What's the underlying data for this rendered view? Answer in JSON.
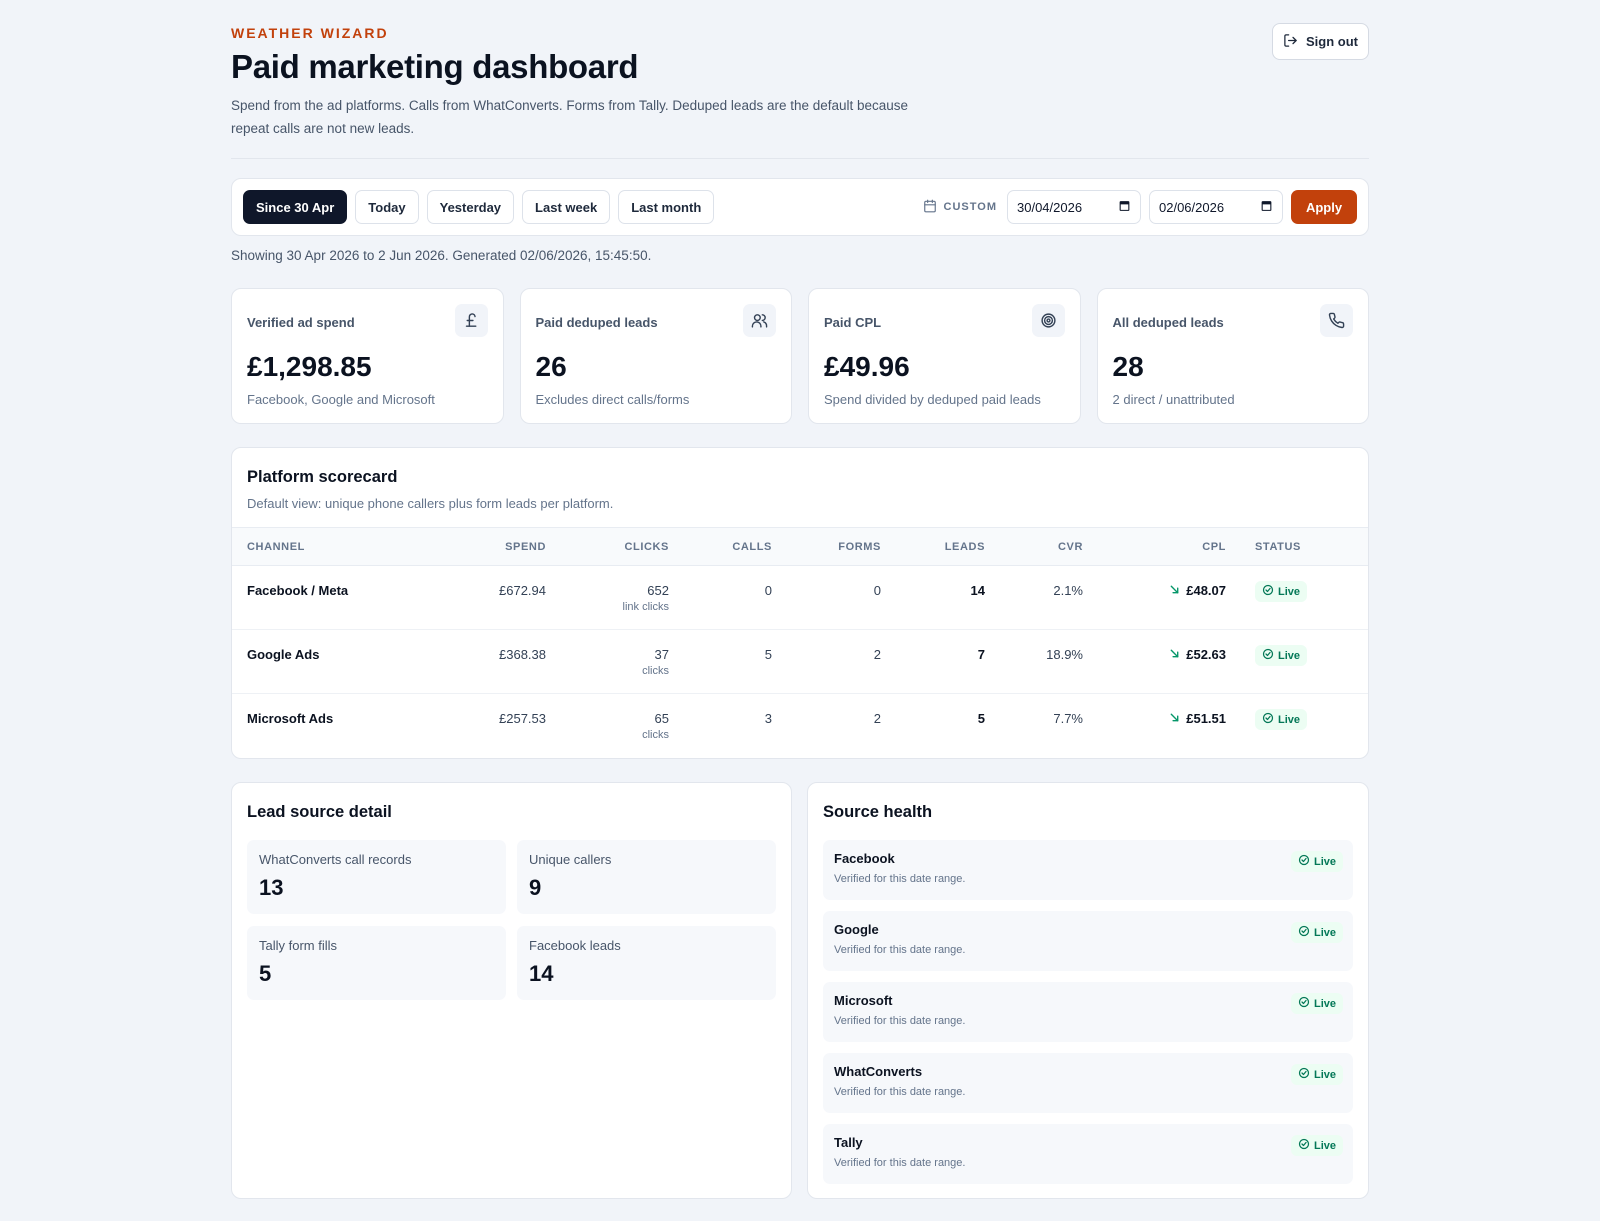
{
  "brand": "WEATHER WIZARD",
  "title": "Paid marketing dashboard",
  "subtitle": "Spend from the ad platforms. Calls from WhatConverts. Forms from Tally. Deduped leads are the default because repeat calls are not new leads.",
  "signout_label": "Sign out",
  "filters": {
    "presets": [
      "Since 30 Apr",
      "Today",
      "Yesterday",
      "Last week",
      "Last month"
    ],
    "custom_label": "CUSTOM",
    "from_date": "30/04/2026",
    "to_date": "02/06/2026",
    "apply_label": "Apply"
  },
  "showing": "Showing 30 Apr 2026 to 2 Jun 2026. Generated 02/06/2026, 15:45:50.",
  "kpis": [
    {
      "label": "Verified ad spend",
      "value": "£1,298.85",
      "note": "Facebook, Google and Microsoft",
      "icon": "pound-icon"
    },
    {
      "label": "Paid deduped leads",
      "value": "26",
      "note": "Excludes direct calls/forms",
      "icon": "users-icon"
    },
    {
      "label": "Paid CPL",
      "value": "£49.96",
      "note": "Spend divided by deduped paid leads",
      "icon": "target-icon"
    },
    {
      "label": "All deduped leads",
      "value": "28",
      "note": "2 direct / unattributed",
      "icon": "phone-icon"
    }
  ],
  "scorecard": {
    "title": "Platform scorecard",
    "subtitle": "Default view: unique phone callers plus form leads per platform.",
    "columns": [
      "CHANNEL",
      "SPEND",
      "CLICKS",
      "CALLS",
      "FORMS",
      "LEADS",
      "CVR",
      "CPL",
      "STATUS"
    ],
    "rows": [
      {
        "channel": "Facebook / Meta",
        "spend": "£672.94",
        "clicks": "652",
        "clicks_note": "link clicks",
        "calls": "0",
        "forms": "0",
        "leads": "14",
        "cvr": "2.1%",
        "cpl": "£48.07",
        "status": "Live"
      },
      {
        "channel": "Google Ads",
        "spend": "£368.38",
        "clicks": "37",
        "clicks_note": "clicks",
        "calls": "5",
        "forms": "2",
        "leads": "7",
        "cvr": "18.9%",
        "cpl": "£52.63",
        "status": "Live"
      },
      {
        "channel": "Microsoft Ads",
        "spend": "£257.53",
        "clicks": "65",
        "clicks_note": "clicks",
        "calls": "3",
        "forms": "2",
        "leads": "5",
        "cvr": "7.7%",
        "cpl": "£51.51",
        "status": "Live"
      }
    ]
  },
  "lead_detail": {
    "title": "Lead source detail",
    "tiles": [
      {
        "label": "WhatConverts call records",
        "value": "13"
      },
      {
        "label": "Unique callers",
        "value": "9"
      },
      {
        "label": "Tally form fills",
        "value": "5"
      },
      {
        "label": "Facebook leads",
        "value": "14"
      }
    ]
  },
  "source_health": {
    "title": "Source health",
    "items": [
      {
        "name": "Facebook",
        "note": "Verified for this date range.",
        "status": "Live"
      },
      {
        "name": "Google",
        "note": "Verified for this date range.",
        "status": "Live"
      },
      {
        "name": "Microsoft",
        "note": "Verified for this date range.",
        "status": "Live"
      },
      {
        "name": "WhatConverts",
        "note": "Verified for this date range.",
        "status": "Live"
      },
      {
        "name": "Tally",
        "note": "Verified for this date range.",
        "status": "Live"
      }
    ]
  },
  "colors": {
    "accent": "#c2410c",
    "live": "#047857",
    "live_bg": "#ecfdf3",
    "dark": "#0f172a"
  }
}
